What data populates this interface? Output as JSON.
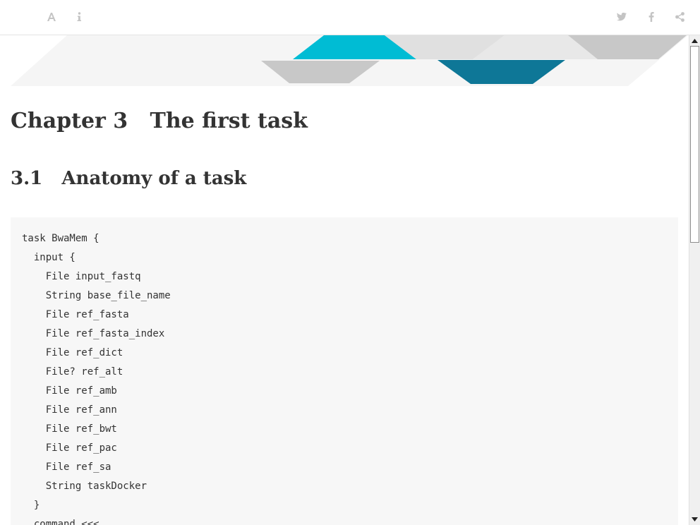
{
  "toolbar": {
    "font_settings_icon": "font-settings-icon",
    "info_icon": "info-icon",
    "twitter_icon": "twitter-icon",
    "facebook_icon": "facebook-icon",
    "share_icon": "share-icon",
    "icon_color": "#c4c4c4"
  },
  "banner": {
    "colors": [
      "#00bcd4",
      "#0e7797",
      "#d9d9d9",
      "#c8c8c8",
      "#f5f5f5"
    ]
  },
  "chapter": {
    "title": "Chapter 3   The first task"
  },
  "section": {
    "title": "3.1   Anatomy of a task"
  },
  "code": {
    "lines": [
      "task BwaMem {",
      "  input {",
      "    File input_fastq",
      "    String base_file_name",
      "    File ref_fasta",
      "    File ref_fasta_index",
      "    File ref_dict",
      "    File? ref_alt",
      "    File ref_amb",
      "    File ref_ann",
      "    File ref_bwt",
      "    File ref_pac",
      "    File ref_sa",
      "    String taskDocker",
      "  }",
      "  command <<<"
    ]
  },
  "scrollbar": {
    "position_fraction": 0.0
  }
}
